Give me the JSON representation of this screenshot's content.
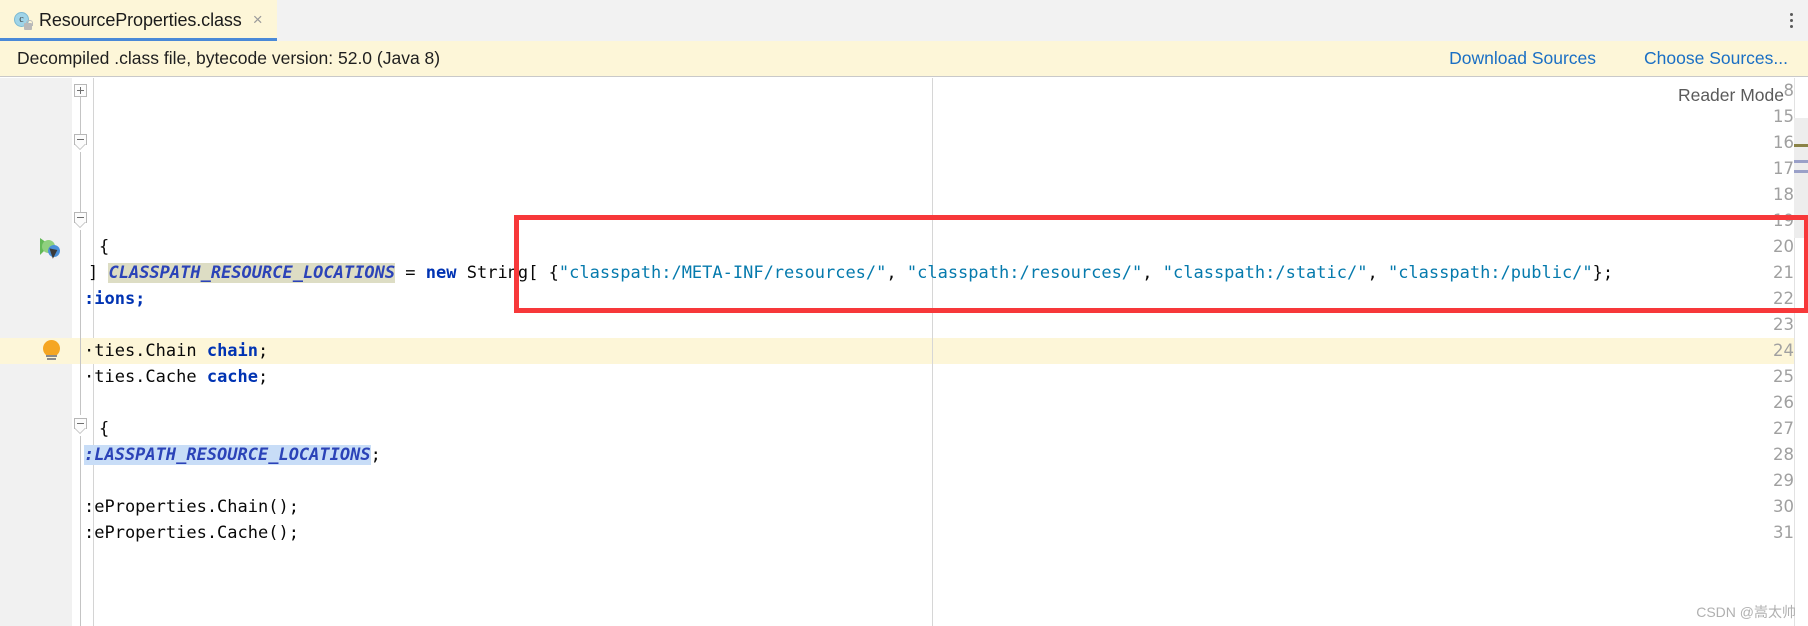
{
  "window": {
    "tab": {
      "title": "ResourceProperties.class",
      "icon": "java-class-locked-icon",
      "close_label": "×"
    },
    "more_actions_label": "more-options"
  },
  "banner": {
    "message": "Decompiled .class file, bytecode version: 52.0 (Java 8)",
    "download_sources": "Download Sources",
    "choose_sources": "Choose Sources...",
    "background": "#fdf6d8",
    "link_color": "#1a6fc4"
  },
  "editor": {
    "reader_mode": "Reader Mode",
    "lines": [
      {
        "num": "8",
        "fold": "plus",
        "text": ""
      },
      {
        "num": "15",
        "fold": "",
        "text": ""
      },
      {
        "num": "16",
        "fold": "arrow",
        "text": ""
      },
      {
        "num": "17",
        "fold": "",
        "text": ""
      },
      {
        "num": "18",
        "fold": "",
        "text": ""
      },
      {
        "num": "19",
        "fold": "arrow",
        "text": ""
      },
      {
        "num": "20",
        "fold": "",
        "text": "{"
      },
      {
        "num": "21",
        "fold": "",
        "text": "] CLASSPATH_RESOURCE_LOCATIONS = new String[ {\"classpath:/META-INF/resources/\", \"classpath:/resources/\", \"classpath:/static/\", \"classpath:/public/\"};"
      },
      {
        "num": "22",
        "fold": "",
        "text": ":ions;"
      },
      {
        "num": "23",
        "fold": "",
        "text": ""
      },
      {
        "num": "24",
        "fold": "",
        "text": "·ties.Chain chain;"
      },
      {
        "num": "25",
        "fold": "",
        "text": "·ties.Cache cache;"
      },
      {
        "num": "26",
        "fold": "",
        "text": ""
      },
      {
        "num": "27",
        "fold": "arrow",
        "text": "{"
      },
      {
        "num": "28",
        "fold": "",
        "text": ":LASSPATH_RESOURCE_LOCATIONS;"
      },
      {
        "num": "29",
        "fold": "",
        "text": ""
      },
      {
        "num": "30",
        "fold": "",
        "text": ":eProperties.Chain();"
      },
      {
        "num": "31",
        "fold": "",
        "text": ":eProperties.Cache();"
      }
    ],
    "line21": {
      "prefix": "] ",
      "field_name": "CLASSPATH_RESOURCE_LOCATIONS",
      "assign": " = ",
      "keyword_new": "new",
      "type": " String[ ",
      "brace_open": "{",
      "strings": [
        "\"classpath:/META-INF/resources/\"",
        "\"classpath:/resources/\"",
        "\"classpath:/static/\"",
        "\"classpath:/public/\""
      ],
      "separator": ", ",
      "tail": "};"
    },
    "line22_text": ":ions;",
    "line24": {
      "prefix": "·ties.Chain ",
      "name": "chain",
      "tail": ";"
    },
    "line25": {
      "prefix": "·ties.Cache ",
      "name": "cache",
      "tail": ";"
    },
    "line27_text": "{",
    "line28": {
      "name": ":LASSPATH_RESOURCE_LOCATIONS",
      "tail": ";"
    },
    "line30_text": ":eProperties.Chain();",
    "line31_text": ":eProperties.Cache();",
    "line20_text": "{",
    "gutter_icons": {
      "line20": "run-gradle-icon",
      "line21": "intention-bulb-icon"
    }
  },
  "annotation": {
    "type": "red-rectangle-highlight",
    "color": "#f7383a"
  },
  "watermark": {
    "text": "CSDN @嵩太帅"
  }
}
